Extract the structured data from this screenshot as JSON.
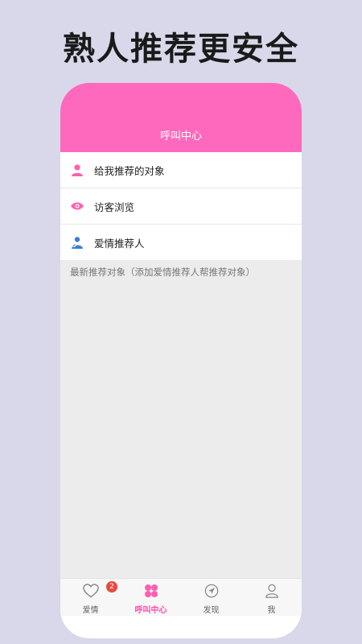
{
  "headline": "熟人推荐更安全",
  "app": {
    "title": "呼叫中心",
    "accent_color": "#ff69bd"
  },
  "menu": [
    {
      "label": "给我推荐的对象",
      "icon": "person-icon"
    },
    {
      "label": "访客浏览",
      "icon": "eye-icon"
    },
    {
      "label": "爱情推荐人",
      "icon": "recommender-icon"
    }
  ],
  "section_note": "最新推荐对象（添加爱情推荐人帮推荐对象）",
  "tabbar": [
    {
      "label": "爱情",
      "icon": "heart-icon",
      "badge": "2"
    },
    {
      "label": "呼叫中心",
      "icon": "clover-icon",
      "active": true
    },
    {
      "label": "发现",
      "icon": "compass-icon"
    },
    {
      "label": "我",
      "icon": "user-icon"
    }
  ]
}
